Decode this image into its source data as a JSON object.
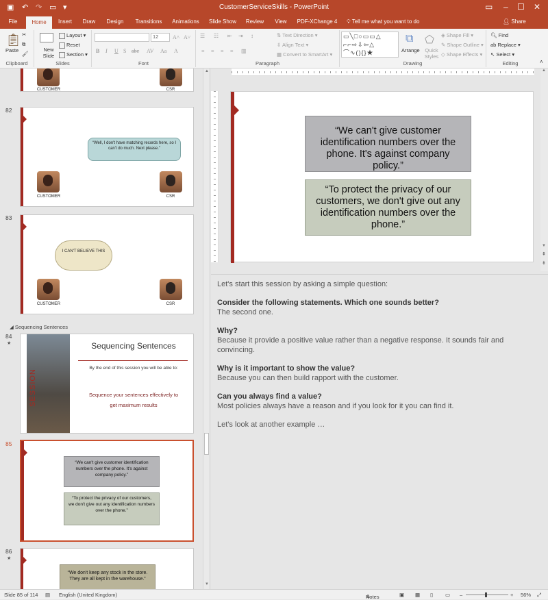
{
  "app": {
    "title": "CustomerServiceSkills - PowerPoint",
    "tell_me": "Tell me what you want to do",
    "share": "Share"
  },
  "tabs": [
    "File",
    "Home",
    "Insert",
    "Draw",
    "Design",
    "Transitions",
    "Animations",
    "Slide Show",
    "Review",
    "View",
    "PDF-XChange 4"
  ],
  "ribbon": {
    "clipboard": {
      "label": "Clipboard",
      "paste": "Paste"
    },
    "slides": {
      "label": "Slides",
      "new_slide": "New Slide",
      "layout": "Layout",
      "reset": "Reset",
      "section": "Section"
    },
    "font": {
      "label": "Font",
      "size": "12"
    },
    "paragraph": {
      "label": "Paragraph",
      "text_direction": "Text Direction",
      "align_text": "Align Text",
      "convert": "Convert to SmartArt"
    },
    "drawing": {
      "label": "Drawing",
      "arrange": "Arrange",
      "quick_styles": "Quick Styles",
      "shape_fill": "Shape Fill",
      "shape_outline": "Shape Outline",
      "shape_effects": "Shape Effects"
    },
    "editing": {
      "label": "Editing",
      "find": "Find",
      "replace": "Replace",
      "select": "Select"
    }
  },
  "thumbs": {
    "s81": {
      "left": "CUSTOMER",
      "right": "CSR"
    },
    "s82": {
      "num": "82",
      "bubble": "“Well, I don't have matching records here, so I can't do much. Next please.”",
      "left": "CUSTOMER",
      "right": "CSR"
    },
    "s83": {
      "num": "83",
      "cloud": "I CAN'T BELIEVE THIS",
      "left": "CUSTOMER",
      "right": "CSR"
    },
    "section": "Sequencing Sentences",
    "s84": {
      "num": "84",
      "title": "Sequencing Sentences",
      "session": "SESSION",
      "objective": "By the end of this session you will be able to:",
      "bullet1": "Sequence your sentences effectively to",
      "bullet2": "get maximum results"
    },
    "s85": {
      "num": "85",
      "q1": "“We can't give customer identification numbers over the phone. It's against company policy.”",
      "q2": "“To protect the privacy of our customers, we don't give out any identification numbers over the phone.”"
    },
    "s86": {
      "num": "86",
      "q1": "“We don't keep any stock in the store. They are all kept in the warehouse.”"
    }
  },
  "slide": {
    "q1": "“We can't give customer identification numbers over the phone. It's against company policy.”",
    "q2": "“To protect the privacy of our customers, we don't give out any identification numbers over the phone.”"
  },
  "notes": {
    "intro": "Let's start this session by asking a simple question:",
    "q1": "Consider the following statements. Which one sounds better?",
    "a1": "The second one.",
    "q2": "Why?",
    "a2": "Because it provide a positive value rather than a negative response. It sounds fair and convincing.",
    "q3": "Why is it important to show the value?",
    "a3": "Because you can then build rapport with the customer.",
    "q4": "Can you always find a value?",
    "a4": "Most policies always have a reason and if you look for it you can find it.",
    "outro": "Let's look at another example …"
  },
  "status": {
    "slide": "Slide 85 of 114",
    "lang": "English (United Kingdom)",
    "notes": "Notes",
    "zoom": "56%"
  }
}
